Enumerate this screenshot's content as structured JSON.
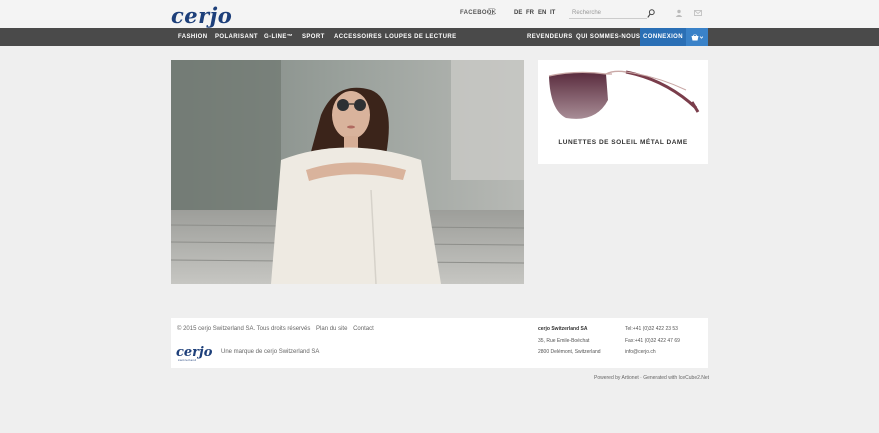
{
  "header": {
    "logo": "cerjo",
    "facebook": "FACEBOOK",
    "languages": [
      "DE",
      "FR",
      "EN",
      "IT"
    ],
    "search_placeholder": "Recherche"
  },
  "nav": {
    "items": [
      "FASHION",
      "POLARISANT",
      "G-LINE™",
      "SPORT",
      "ACCESSOIRES",
      "LOUPES DE LECTURE"
    ],
    "right_items": [
      "REVENDEURS",
      "QUI SOMMES-NOUS ?"
    ],
    "login": "CONNEXION"
  },
  "product": {
    "title": "LUNETTES DE SOLEIL MÉTAL DAME"
  },
  "footer": {
    "copyright": "© 2015 cerjo Switzerland SA. Tous droits réservés",
    "links": [
      "Plan du site",
      "Contact"
    ],
    "logo": "cerjo",
    "logo_sub": "switzerland",
    "brand_line": "Une marque de cerjo Switzerland SA",
    "company": "cerjo Switzerland SA",
    "address_lines": [
      "35, Rue Emile-Boéchat",
      "2800 Delémont, Switzerland"
    ],
    "tel": "Tel:+41 (0)32 422 23 53",
    "fax": "Fax:+41 (0)32 422 47 69",
    "email": "info@cerjo.ch",
    "powered": "Powered by Artionet · Generated with IceCube2.Net"
  },
  "colors": {
    "nav_bg": "#4a4a4a",
    "accent": "#2a6fb5",
    "logo": "#1d3f7a"
  }
}
